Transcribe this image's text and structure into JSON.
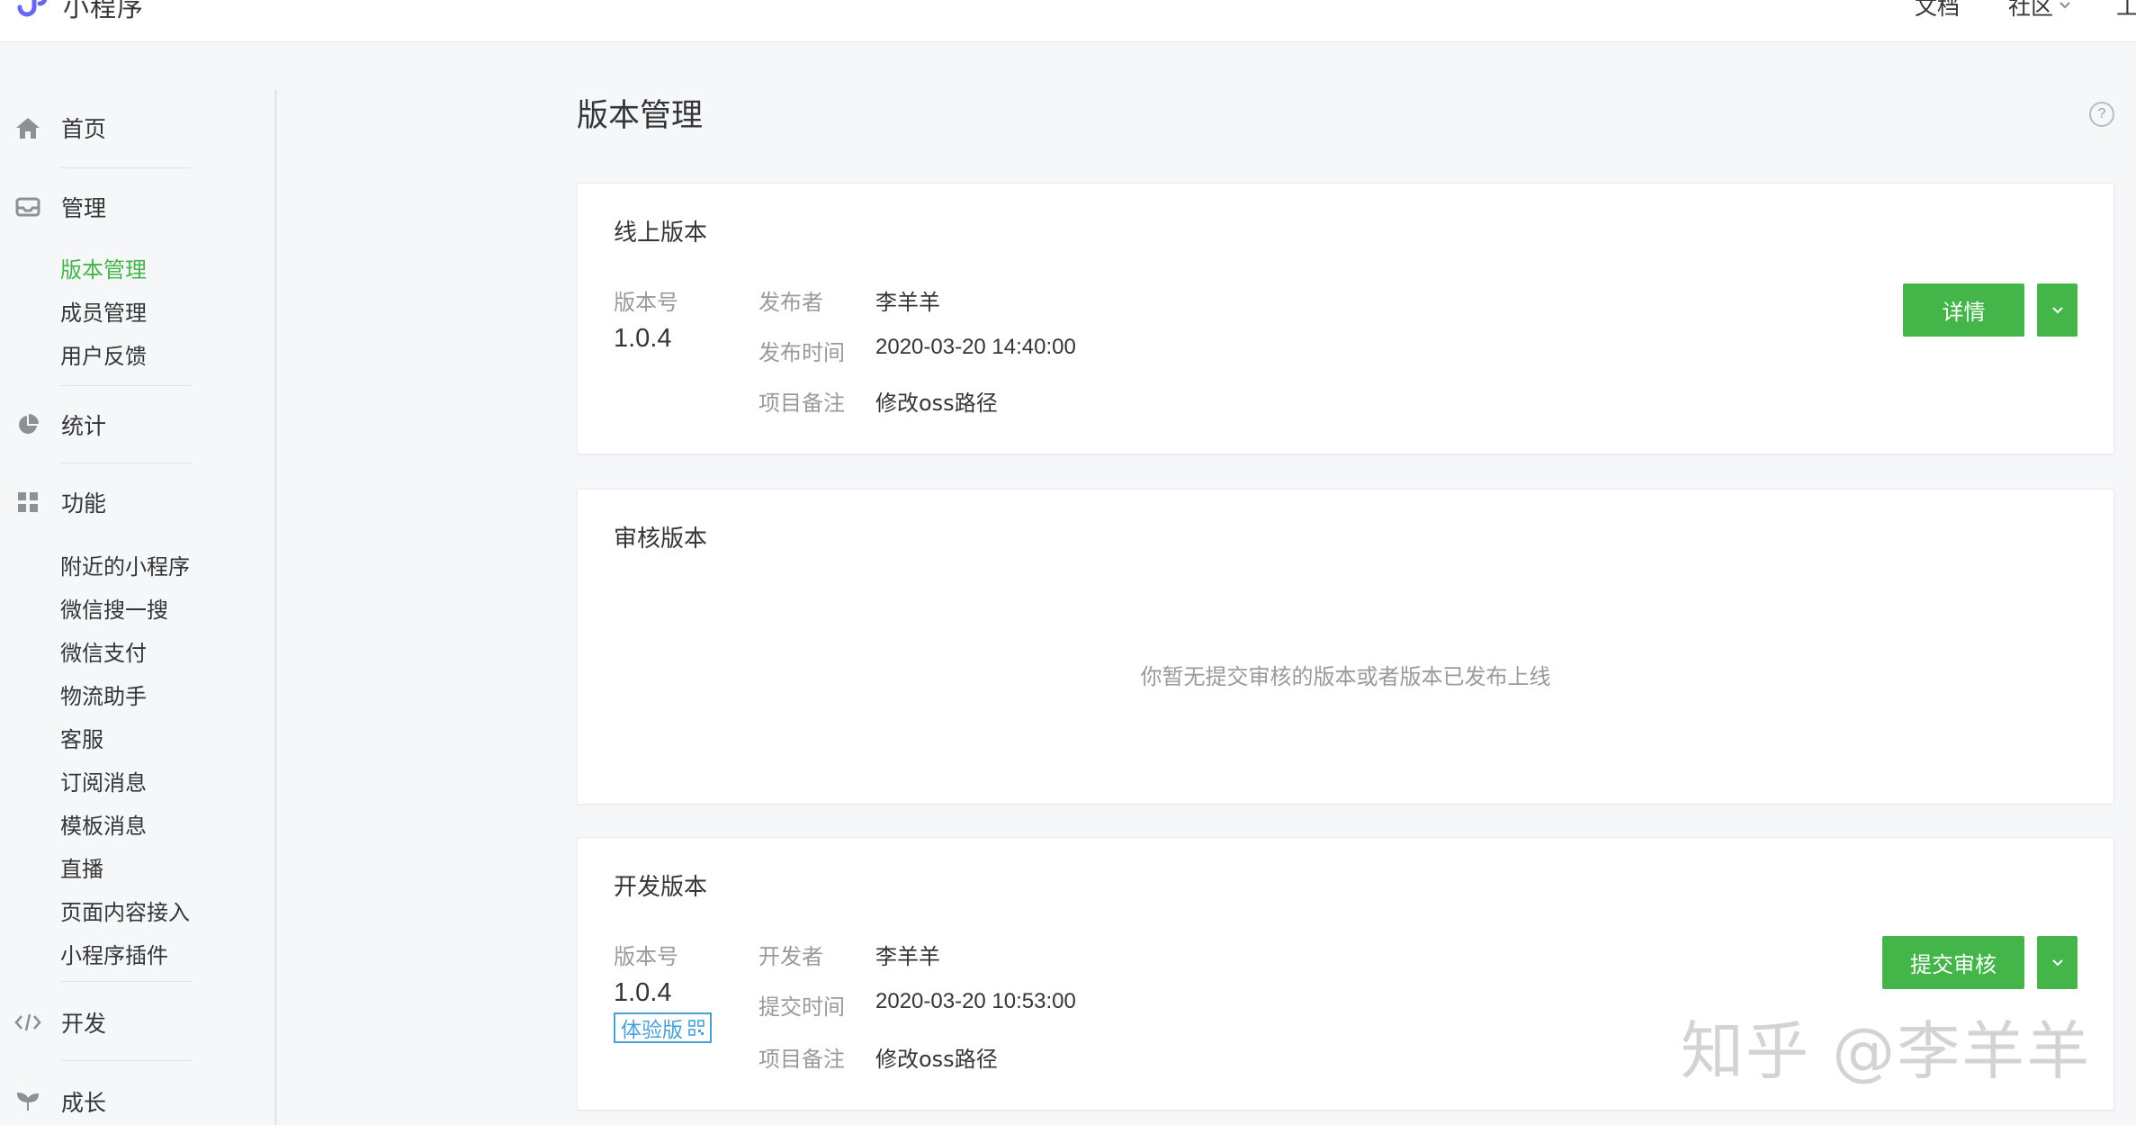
{
  "topbar": {
    "brand": "小程序",
    "links": {
      "docs": "文档",
      "community": "社区",
      "more": "工"
    }
  },
  "sidebar": {
    "sections": {
      "home": "首页",
      "manage": "管理",
      "stats": "统计",
      "features": "功能",
      "develop": "开发",
      "growth": "成长"
    },
    "manage_items": [
      "版本管理",
      "成员管理",
      "用户反馈"
    ],
    "feature_items": [
      "附近的小程序",
      "微信搜一搜",
      "微信支付",
      "物流助手",
      "客服",
      "订阅消息",
      "模板消息",
      "直播",
      "页面内容接入",
      "小程序插件"
    ]
  },
  "page": {
    "title": "版本管理",
    "help": "?"
  },
  "online": {
    "title": "线上版本",
    "version_label": "版本号",
    "version": "1.0.4",
    "fields": [
      {
        "label": "发布者",
        "value": "李羊羊"
      },
      {
        "label": "发布时间",
        "value": "2020-03-20 14:40:00"
      },
      {
        "label": "项目备注",
        "value": "修改oss路径"
      }
    ],
    "button": "详情"
  },
  "review": {
    "title": "审核版本",
    "empty": "你暂无提交审核的版本或者版本已发布上线"
  },
  "dev": {
    "title": "开发版本",
    "version_label": "版本号",
    "version": "1.0.4",
    "badge": "体验版",
    "fields": [
      {
        "label": "开发者",
        "value": "李羊羊"
      },
      {
        "label": "提交时间",
        "value": "2020-03-20 10:53:00"
      },
      {
        "label": "项目备注",
        "value": "修改oss路径"
      }
    ],
    "button": "提交审核"
  },
  "watermark": "知乎 @李羊羊",
  "colors": {
    "accent": "#44b549",
    "link": "#4a9fd7",
    "muted": "#9a9a9a"
  }
}
